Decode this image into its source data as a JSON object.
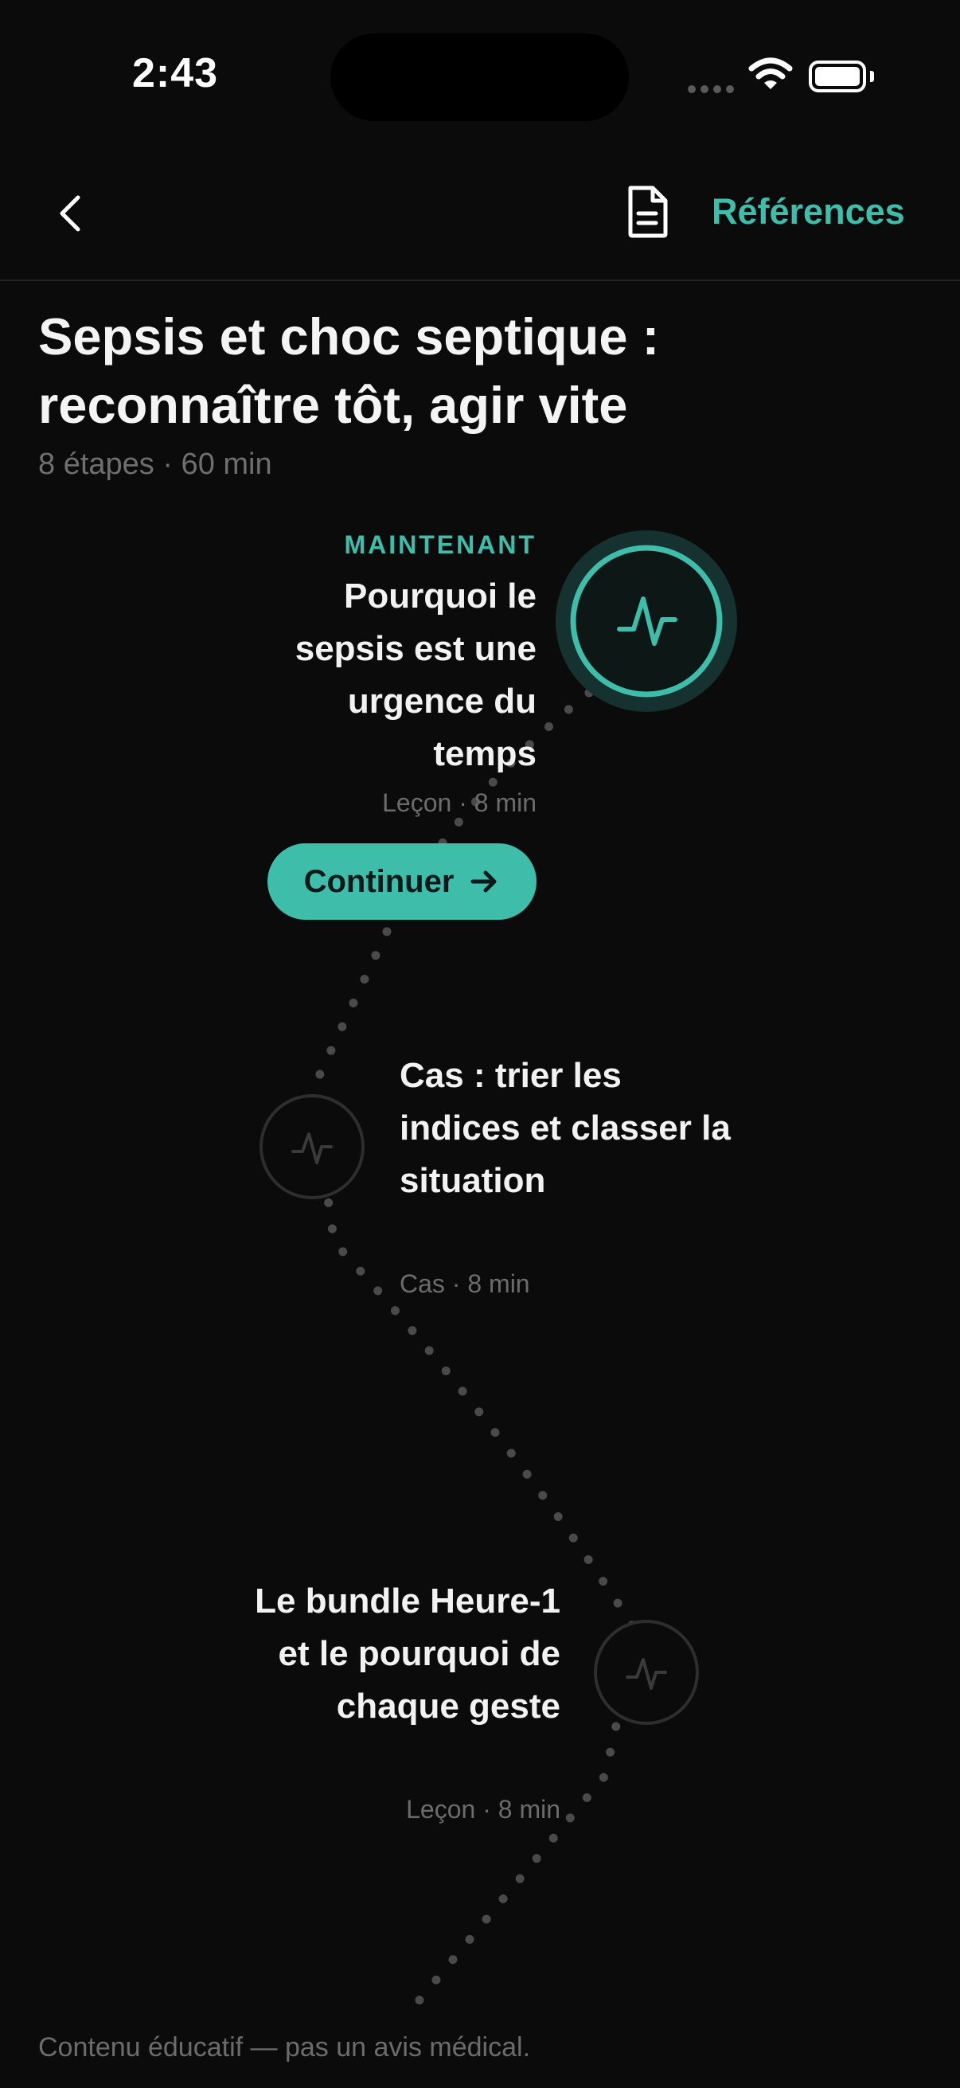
{
  "status_bar": {
    "time": "2:43"
  },
  "nav": {
    "back_icon": "chevron-left-icon",
    "doc_icon": "document-icon",
    "references_label": "Références"
  },
  "course": {
    "title": "Sepsis et choc septique : reconnaître tôt, agir vite",
    "meta": "8 étapes · 60 min"
  },
  "steps": [
    {
      "tag": "MAINTENANT",
      "title": "Pourquoi le sepsis est une urgence du temps",
      "meta": "Leçon · 8 min",
      "icon": "pulse-icon",
      "state": "current",
      "button_label": "Continuer"
    },
    {
      "title": "Cas : trier les indices et classer la situation",
      "meta": "Cas · 8 min",
      "icon": "pulse-icon",
      "state": "locked"
    },
    {
      "title": "Le bundle Heure-1 et le pourquoi de chaque geste",
      "meta": "Leçon · 8 min",
      "icon": "pulse-icon",
      "state": "locked"
    }
  ],
  "footer": {
    "disclaimer": "Contenu éducatif — pas un avis médical."
  },
  "colors": {
    "accent": "#3fbdab",
    "background": "#0b0b0b",
    "muted": "#6c6c6c"
  }
}
